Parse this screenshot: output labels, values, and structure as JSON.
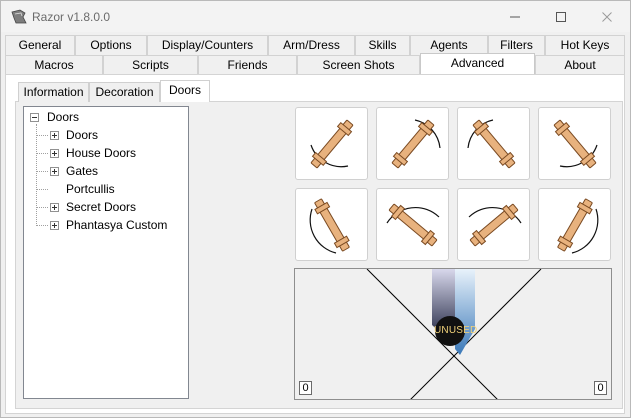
{
  "window": {
    "title": "Razor v1.8.0.0"
  },
  "tabs_row1": [
    {
      "label": "General"
    },
    {
      "label": "Options"
    },
    {
      "label": "Display/Counters"
    },
    {
      "label": "Arm/Dress"
    },
    {
      "label": "Skills"
    },
    {
      "label": "Agents"
    },
    {
      "label": "Filters"
    },
    {
      "label": "Hot Keys"
    }
  ],
  "tabs_row2": [
    {
      "label": "Macros"
    },
    {
      "label": "Scripts"
    },
    {
      "label": "Friends"
    },
    {
      "label": "Screen Shots"
    },
    {
      "label": "Advanced"
    },
    {
      "label": "About"
    }
  ],
  "active_tab": "Advanced",
  "subtabs": [
    {
      "label": "Information"
    },
    {
      "label": "Decoration"
    },
    {
      "label": "Doors"
    }
  ],
  "active_subtab": "Doors",
  "tree": {
    "root": "Doors",
    "children": [
      {
        "label": "Doors",
        "expandable": true
      },
      {
        "label": "House Doors",
        "expandable": true
      },
      {
        "label": "Gates",
        "expandable": true
      },
      {
        "label": "Portcullis",
        "expandable": false
      },
      {
        "label": "Secret Doors",
        "expandable": true
      },
      {
        "label": "Phantasya Custom",
        "expandable": true
      }
    ]
  },
  "door_buttons": [
    {
      "icon": "door-swing-icon"
    },
    {
      "icon": "door-swing-icon"
    },
    {
      "icon": "door-swing-icon"
    },
    {
      "icon": "door-swing-icon"
    },
    {
      "icon": "door-swing-icon"
    },
    {
      "icon": "door-swing-icon"
    },
    {
      "icon": "door-swing-icon"
    },
    {
      "icon": "door-swing-icon"
    }
  ],
  "preview": {
    "item_label": "UNUSED",
    "coord_left": "0",
    "coord_right": "0"
  },
  "colors": {
    "wood": "#e8b27e",
    "wood_edge": "#7a4a22",
    "tab_border": "#d2d2d2",
    "tree_border": "#828790"
  }
}
